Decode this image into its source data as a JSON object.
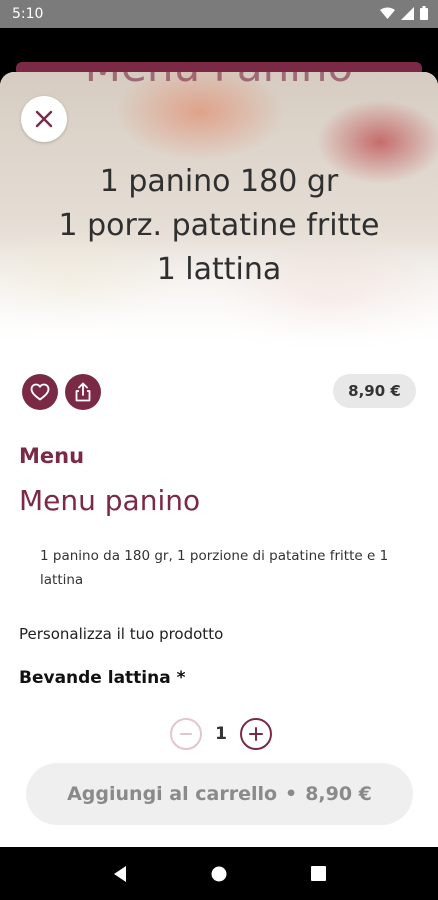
{
  "status_bar": {
    "time": "5:10",
    "icons": [
      "wifi-icon",
      "signal-icon",
      "battery-icon"
    ]
  },
  "hero": {
    "background_title": "Menu Panino",
    "lines": [
      "1 panino 180 gr",
      "1 porz. patatine fritte",
      "1 lattina"
    ]
  },
  "product": {
    "price": "8,90 €",
    "category": "Menu",
    "name": "Menu panino",
    "description": "1 panino da 180 gr, 1 porzione di patatine fritte e 1 lattina"
  },
  "customization": {
    "title": "Personalizza il tuo prodotto",
    "group_label": "Bevande lattina *"
  },
  "quantity": {
    "value": "1"
  },
  "cart_button": {
    "label": "Aggiungi al carrello",
    "separator": "•",
    "price": "8,90 €"
  },
  "colors": {
    "accent": "#7a2a45",
    "button_bg": "#efefef",
    "badge_bg": "#e8e8e8"
  }
}
